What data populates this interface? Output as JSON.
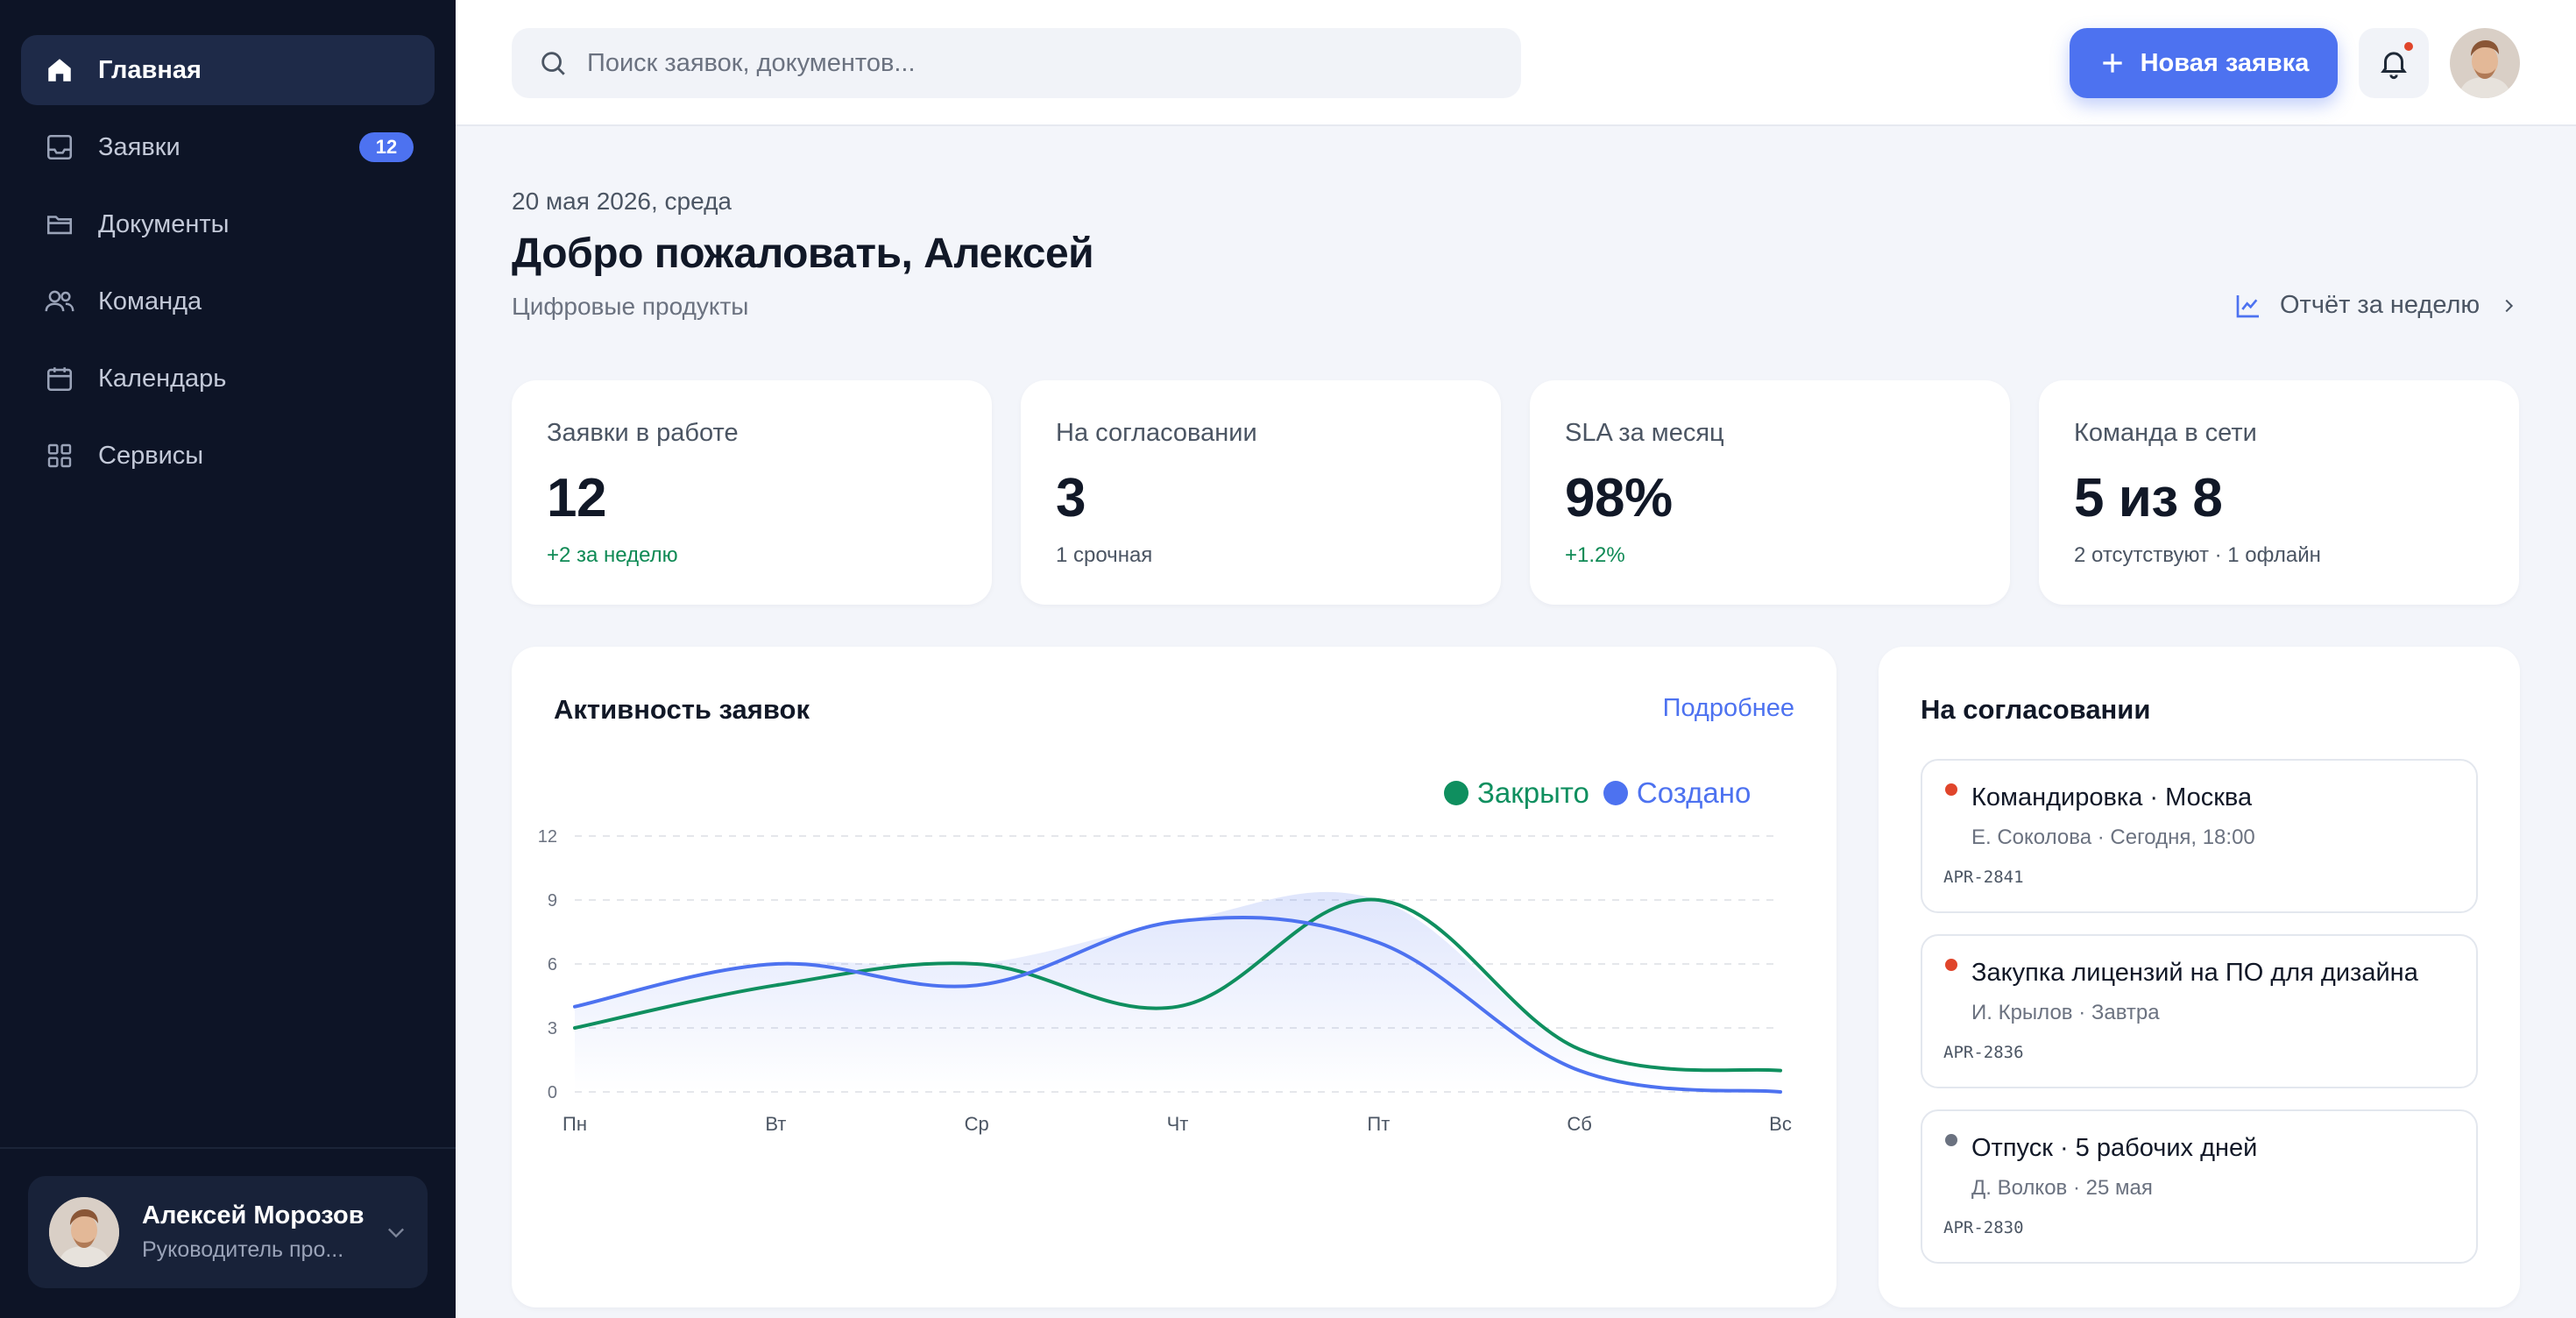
{
  "sidebar": {
    "items": [
      {
        "label": "Главная",
        "icon": "home-icon"
      },
      {
        "label": "Заявки",
        "icon": "inbox-icon",
        "badge": "12"
      },
      {
        "label": "Документы",
        "icon": "folder-icon"
      },
      {
        "label": "Команда",
        "icon": "users-icon"
      },
      {
        "label": "Календарь",
        "icon": "calendar-icon"
      },
      {
        "label": "Сервисы",
        "icon": "grid-icon"
      }
    ],
    "user": {
      "name": "Алексей Морозов",
      "role": "Руководитель про..."
    }
  },
  "header": {
    "search_placeholder": "Поиск заявок, документов...",
    "new_request_label": "Новая заявка"
  },
  "greeting": {
    "date": "20 мая 2026, среда",
    "title": "Добро пожаловать, Алексей",
    "subtitle": "Цифровые продукты",
    "report_link": "Отчёт за неделю"
  },
  "stats": [
    {
      "label": "Заявки в работе",
      "value": "12",
      "note": "+2 за неделю"
    },
    {
      "label": "На согласовании",
      "value": "3",
      "note": "1 срочная"
    },
    {
      "label": "SLA за месяц",
      "value": "98%",
      "note": "+1.2%"
    },
    {
      "label": "Команда в сети",
      "value": "5 из 8",
      "note": "2 отсутствуют · 1 офлайн"
    }
  ],
  "activity": {
    "title": "Активность заявок",
    "more_link": "Подробнее"
  },
  "chart_data": {
    "type": "line",
    "categories": [
      "Пн",
      "Вт",
      "Ср",
      "Чт",
      "Пт",
      "Сб",
      "Вс"
    ],
    "series": [
      {
        "name": "Закрыто",
        "color": "#0f8f5f",
        "values": [
          3,
          5,
          6,
          4,
          9,
          2,
          1
        ]
      },
      {
        "name": "Создано",
        "color": "#4d72f0",
        "values": [
          4,
          6,
          5,
          8,
          7,
          1,
          0
        ]
      }
    ],
    "y_ticks": [
      "0",
      "3",
      "6",
      "9",
      "12"
    ],
    "ylim": [
      0,
      12
    ],
    "grid": true,
    "legend": "top-right"
  },
  "approvals": {
    "title": "На согласовании",
    "items": [
      {
        "name": "Командировка · Москва",
        "meta": "Е. Соколова · Сегодня, 18:00",
        "id": "APR-2841",
        "dot_color": "#e0452b"
      },
      {
        "name": "Закупка лицензий на ПО для дизайна",
        "meta": "И. Крылов · Завтра",
        "id": "APR-2836",
        "dot_color": "#e0452b"
      },
      {
        "name": "Отпуск · 5 рабочих дней",
        "meta": "Д. Волков · 25 мая",
        "id": "APR-2830",
        "dot_color": "#6b7280"
      }
    ]
  }
}
